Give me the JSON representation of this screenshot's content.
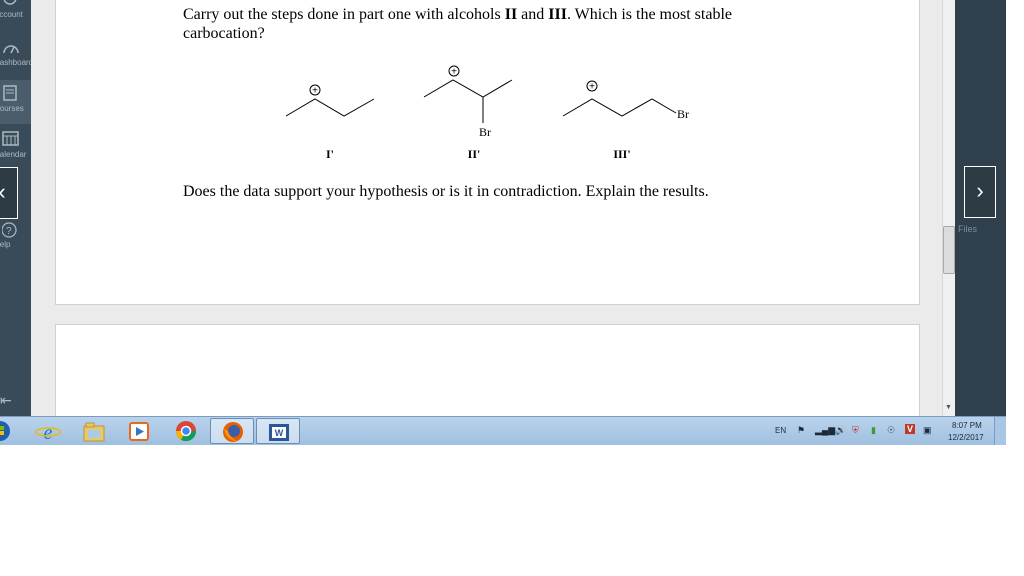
{
  "nav": {
    "items": [
      {
        "label": "Account"
      },
      {
        "label": "Dashboard"
      },
      {
        "label": "Courses"
      },
      {
        "label": "Calendar"
      },
      {
        "label": "Help"
      }
    ]
  },
  "content": {
    "q1_part1": "Carry out the steps done in part one with alcohols ",
    "q1_bold1": "II",
    "q1_and": " and ",
    "q1_bold2": "III",
    "q1_part2": ".  Which is the most stable carbocation?",
    "q2": "Does the data support your hypothesis or is it in contradiction. Explain the results.",
    "molecules": {
      "labels": [
        "I'",
        "II'",
        "III'"
      ],
      "charge_symbol": "+",
      "br": "Br"
    }
  },
  "sidebar": {
    "files_label": "Files"
  },
  "taskbar": {
    "language": "EN",
    "time": "8:07 PM",
    "date": "12/2/2017"
  }
}
